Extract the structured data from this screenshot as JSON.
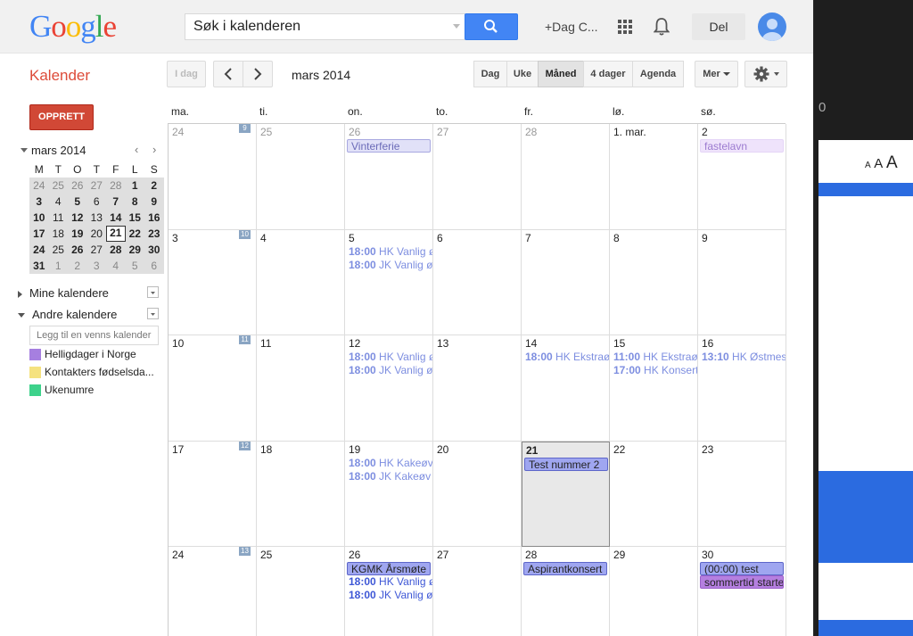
{
  "header": {
    "logo_letters": [
      {
        "ch": "G",
        "color": "#4285f4"
      },
      {
        "ch": "o",
        "color": "#ea4335"
      },
      {
        "ch": "o",
        "color": "#fbbc05"
      },
      {
        "ch": "g",
        "color": "#4285f4"
      },
      {
        "ch": "l",
        "color": "#34a853"
      },
      {
        "ch": "e",
        "color": "#ea4335"
      }
    ],
    "search_placeholder": "Søk i kalenderen",
    "user_label": "+Dag C...",
    "share_label": "Del"
  },
  "toolbar": {
    "app_title": "Kalender",
    "today_label": "I dag",
    "date_title": "mars 2014",
    "views": [
      {
        "label": "Dag",
        "selected": false
      },
      {
        "label": "Uke",
        "selected": false
      },
      {
        "label": "Måned",
        "selected": true
      },
      {
        "label": "4 dager",
        "selected": false
      },
      {
        "label": "Agenda",
        "selected": false
      }
    ],
    "more_label": "Mer"
  },
  "sidebar": {
    "create_label": "OPPRETT",
    "mini_month": "mars 2014",
    "mini_days": [
      "M",
      "T",
      "O",
      "T",
      "F",
      "L",
      "S"
    ],
    "mini_weeks": [
      [
        "24",
        "25",
        "26",
        "27",
        "28",
        "1",
        "2"
      ],
      [
        "3",
        "4",
        "5",
        "6",
        "7",
        "8",
        "9"
      ],
      [
        "10",
        "11",
        "12",
        "13",
        "14",
        "15",
        "16"
      ],
      [
        "17",
        "18",
        "19",
        "20",
        "21",
        "22",
        "23"
      ],
      [
        "24",
        "25",
        "26",
        "27",
        "28",
        "29",
        "30"
      ],
      [
        "31",
        "1",
        "2",
        "3",
        "4",
        "5",
        "6"
      ]
    ],
    "my_calendars": "Mine kalendere",
    "other_calendars": "Andre kalendere",
    "add_friend_placeholder": "Legg til en venns kalender",
    "calendars": [
      {
        "name": "Helligdager i Norge",
        "color": "#a67fe0"
      },
      {
        "name": "Kontakters fødselsda...",
        "color": "#f5e27f"
      },
      {
        "name": "Ukenumre",
        "color": "#3dd28b"
      }
    ]
  },
  "month": {
    "day_headers": [
      "ma.",
      "ti.",
      "on.",
      "to.",
      "fr.",
      "lø.",
      "sø."
    ],
    "weeks": [
      {
        "week_no": "9",
        "days": [
          "24",
          "25",
          "26",
          "27",
          "28",
          "1. mar.",
          "2"
        ]
      },
      {
        "week_no": "10",
        "days": [
          "3",
          "4",
          "5",
          "6",
          "7",
          "8",
          "9"
        ]
      },
      {
        "week_no": "11",
        "days": [
          "10",
          "11",
          "12",
          "13",
          "14",
          "15",
          "16"
        ]
      },
      {
        "week_no": "12",
        "days": [
          "17",
          "18",
          "19",
          "20",
          "21",
          "22",
          "23"
        ]
      },
      {
        "week_no": "13",
        "days": [
          "24",
          "25",
          "26",
          "27",
          "28",
          "29",
          "30"
        ]
      }
    ],
    "events": [
      {
        "week": 0,
        "day": 2,
        "slot": 0,
        "kind": "bar",
        "text": "Vinterferie",
        "bg": "#e1e1f8",
        "fg": "#6b6bb8",
        "border": "#a8a8e0"
      },
      {
        "week": 0,
        "day": 6,
        "slot": 0,
        "kind": "bar",
        "text": "fastelavn",
        "bg": "#efe3fb",
        "fg": "#9c7bd0",
        "border": "#e5d5f7"
      },
      {
        "week": 1,
        "day": 2,
        "slot": 0,
        "kind": "text",
        "time": "18:00",
        "text": "HK Vanlig øv",
        "fg": "#7d8ee0"
      },
      {
        "week": 1,
        "day": 2,
        "slot": 1,
        "kind": "text",
        "time": "18:00",
        "text": "JK Vanlig øv",
        "fg": "#7d8ee0"
      },
      {
        "week": 2,
        "day": 2,
        "slot": 0,
        "kind": "text",
        "time": "18:00",
        "text": "HK Vanlig øv",
        "fg": "#7d8ee0"
      },
      {
        "week": 2,
        "day": 2,
        "slot": 1,
        "kind": "text",
        "time": "18:00",
        "text": "JK Vanlig øv",
        "fg": "#7d8ee0"
      },
      {
        "week": 2,
        "day": 4,
        "slot": 0,
        "kind": "text",
        "time": "18:00",
        "text": "HK Ekstraøv",
        "fg": "#7d8ee0"
      },
      {
        "week": 2,
        "day": 5,
        "slot": 0,
        "kind": "text",
        "time": "11:00",
        "text": "HK Ekstraøv",
        "fg": "#7d8ee0"
      },
      {
        "week": 2,
        "day": 5,
        "slot": 1,
        "kind": "text",
        "time": "17:00",
        "text": "HK Konsert",
        "fg": "#7d8ee0"
      },
      {
        "week": 2,
        "day": 6,
        "slot": 0,
        "kind": "text",
        "time": "13:10",
        "text": "HK Østmesse",
        "fg": "#7d8ee0"
      },
      {
        "week": 3,
        "day": 2,
        "slot": 0,
        "kind": "text",
        "time": "18:00",
        "text": "HK Kakeøv",
        "fg": "#7d8ee0"
      },
      {
        "week": 3,
        "day": 2,
        "slot": 1,
        "kind": "text",
        "time": "18:00",
        "text": "JK Kakeøv",
        "fg": "#7d8ee0"
      },
      {
        "week": 3,
        "day": 4,
        "slot": 0,
        "kind": "bar",
        "text": "Test nummer 2",
        "bg": "#9fa6f0",
        "fg": "#222",
        "border": "#5d66c9"
      },
      {
        "week": 4,
        "day": 2,
        "slot": 0,
        "kind": "bar",
        "text": "KGMK Årsmøte",
        "bg": "#9fa6f0",
        "fg": "#222",
        "border": "#5d66c9"
      },
      {
        "week": 4,
        "day": 2,
        "slot": 1,
        "kind": "text",
        "time": "18:00",
        "text": "HK Vanlig øv",
        "fg": "#3e57d6"
      },
      {
        "week": 4,
        "day": 2,
        "slot": 2,
        "kind": "text",
        "time": "18:00",
        "text": "JK Vanlig øv",
        "fg": "#3e57d6"
      },
      {
        "week": 4,
        "day": 4,
        "slot": 0,
        "kind": "bar",
        "text": "Aspirantkonsert",
        "bg": "#9fa6f0",
        "fg": "#222",
        "border": "#5d66c9"
      },
      {
        "week": 4,
        "day": 6,
        "slot": 0,
        "kind": "bar",
        "text": "(00:00) test",
        "bg": "#9fa6f0",
        "fg": "#222",
        "border": "#5d66c9"
      },
      {
        "week": 4,
        "day": 6,
        "slot": 1,
        "kind": "bar",
        "text": "sommertid starter",
        "bg": "#b57fe0",
        "fg": "#222",
        "border": "#9a5fc9"
      }
    ]
  },
  "right_pane": {
    "zoom_text": "A A A"
  }
}
